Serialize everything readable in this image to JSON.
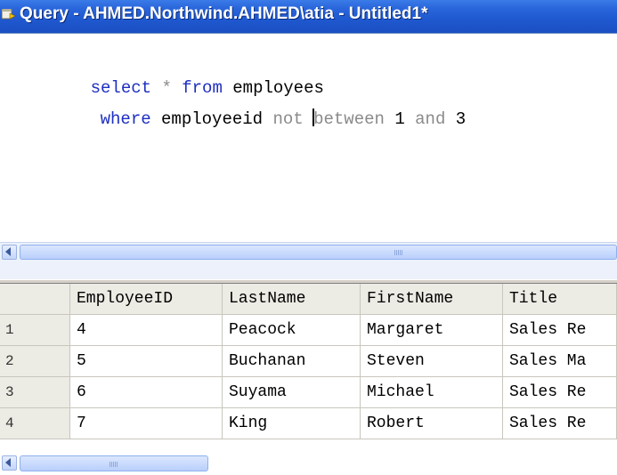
{
  "window": {
    "title": "Query - AHMED.Northwind.AHMED\\atia - Untitled1*"
  },
  "editor": {
    "line1": {
      "kw1": "select",
      "op": "*",
      "kw2": "from",
      "ident": "employees"
    },
    "line2": {
      "kw1": "where",
      "ident": "employeeid",
      "g1": "not",
      "g2": "between",
      "n1": "1",
      "g3": "and",
      "n2": "3"
    }
  },
  "results": {
    "columns": [
      "EmployeeID",
      "LastName",
      "FirstName",
      "Title"
    ],
    "rows": [
      {
        "num": "1",
        "cells": [
          "4",
          "Peacock",
          "Margaret",
          "Sales Re"
        ]
      },
      {
        "num": "2",
        "cells": [
          "5",
          "Buchanan",
          "Steven",
          "Sales Ma"
        ]
      },
      {
        "num": "3",
        "cells": [
          "6",
          "Suyama",
          "Michael",
          "Sales Re"
        ]
      },
      {
        "num": "4",
        "cells": [
          "7",
          "King",
          "Robert",
          "Sales Re"
        ]
      }
    ]
  },
  "colors": {
    "keyword": "#1e2fc0",
    "operator_gray": "#8a8a8a",
    "titlebar": "#2a66db"
  }
}
